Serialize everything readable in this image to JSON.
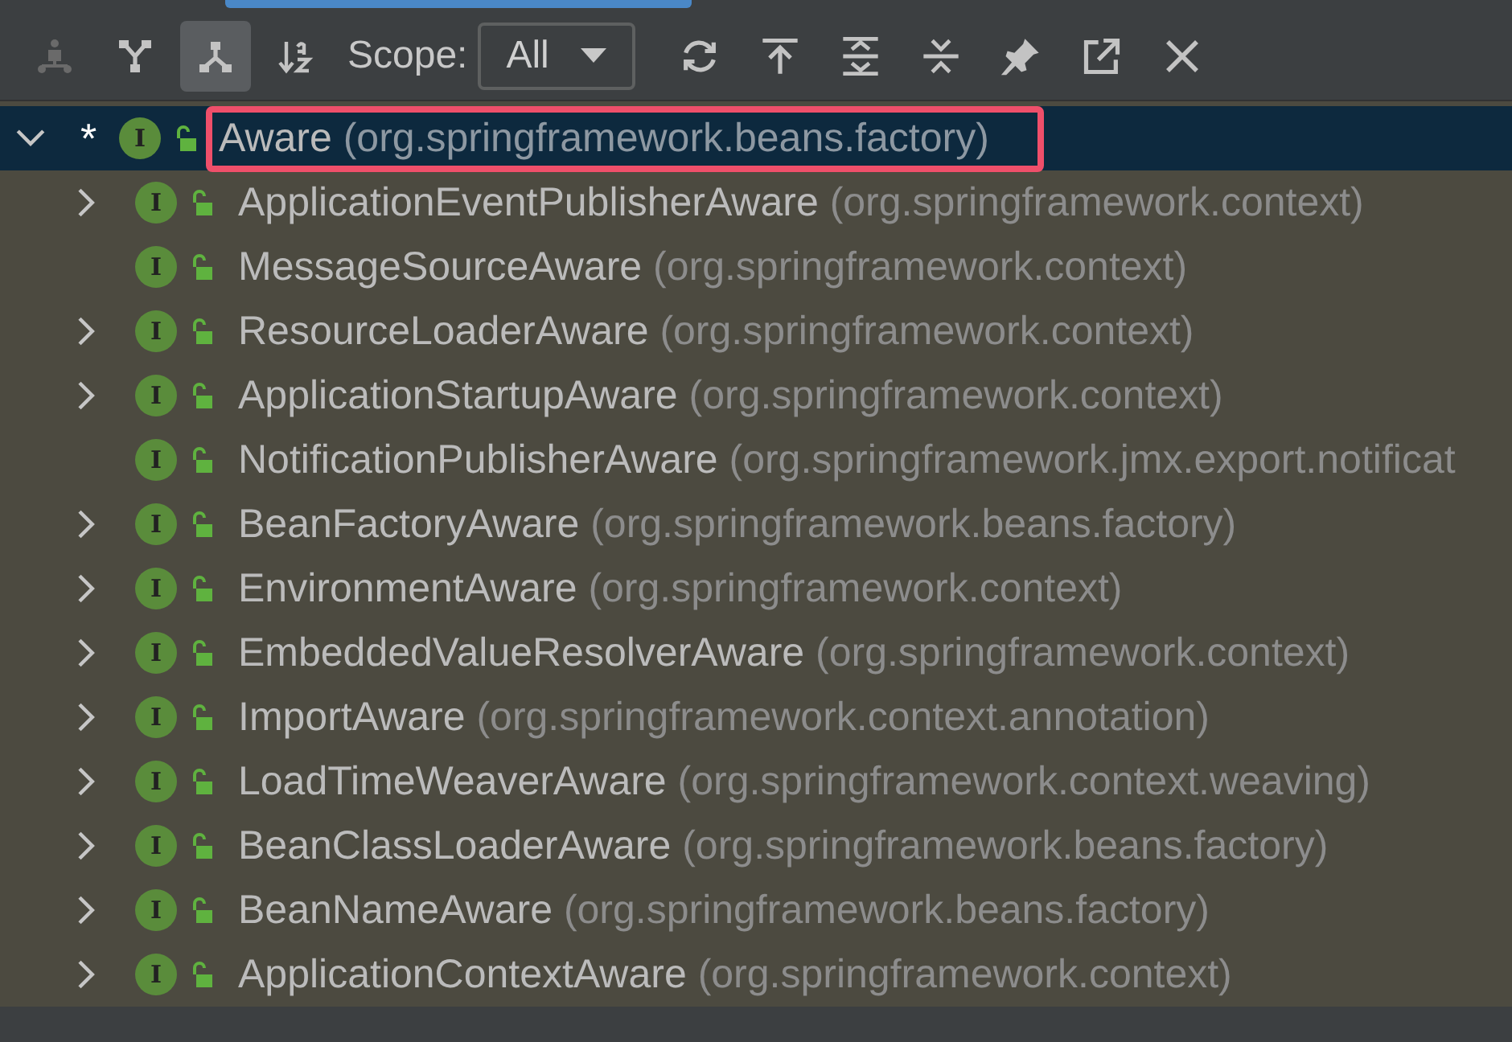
{
  "toolbar": {
    "buttons": [
      {
        "kind": "supertypes",
        "selected": false,
        "disabled": true
      },
      {
        "kind": "subtypes",
        "selected": false,
        "disabled": false
      },
      {
        "kind": "hierarchy",
        "selected": true,
        "disabled": false
      },
      {
        "kind": "sort",
        "selected": false,
        "disabled": false
      }
    ],
    "scope_label": "Scope:",
    "scope_value": "All",
    "actions": [
      {
        "kind": "refresh"
      },
      {
        "kind": "export"
      },
      {
        "kind": "expand"
      },
      {
        "kind": "collapse"
      },
      {
        "kind": "pin"
      },
      {
        "kind": "open"
      },
      {
        "kind": "close"
      }
    ]
  },
  "tree": {
    "badge": "I",
    "name": "Aware",
    "package": "(org.springframework.beans.factory)",
    "mark": "*",
    "expanded": true,
    "selected": true,
    "highlighted": true,
    "children": [
      {
        "badge": "I",
        "name": "ApplicationEventPublisherAware",
        "package": "(org.springframework.context)",
        "expandable": true
      },
      {
        "badge": "I",
        "name": "MessageSourceAware",
        "package": "(org.springframework.context)",
        "expandable": false
      },
      {
        "badge": "I",
        "name": "ResourceLoaderAware",
        "package": "(org.springframework.context)",
        "expandable": true
      },
      {
        "badge": "I",
        "name": "ApplicationStartupAware",
        "package": "(org.springframework.context)",
        "expandable": true
      },
      {
        "badge": "I",
        "name": "NotificationPublisherAware",
        "package": "(org.springframework.jmx.export.notificat",
        "expandable": false
      },
      {
        "badge": "I",
        "name": "BeanFactoryAware",
        "package": "(org.springframework.beans.factory)",
        "expandable": true
      },
      {
        "badge": "I",
        "name": "EnvironmentAware",
        "package": "(org.springframework.context)",
        "expandable": true
      },
      {
        "badge": "I",
        "name": "EmbeddedValueResolverAware",
        "package": "(org.springframework.context)",
        "expandable": true
      },
      {
        "badge": "I",
        "name": "ImportAware",
        "package": "(org.springframework.context.annotation)",
        "expandable": true
      },
      {
        "badge": "I",
        "name": "LoadTimeWeaverAware",
        "package": "(org.springframework.context.weaving)",
        "expandable": true
      },
      {
        "badge": "I",
        "name": "BeanClassLoaderAware",
        "package": "(org.springframework.beans.factory)",
        "expandable": true
      },
      {
        "badge": "I",
        "name": "BeanNameAware",
        "package": "(org.springframework.beans.factory)",
        "expandable": true
      },
      {
        "badge": "I",
        "name": "ApplicationContextAware",
        "package": "(org.springframework.context)",
        "expandable": true
      }
    ]
  }
}
